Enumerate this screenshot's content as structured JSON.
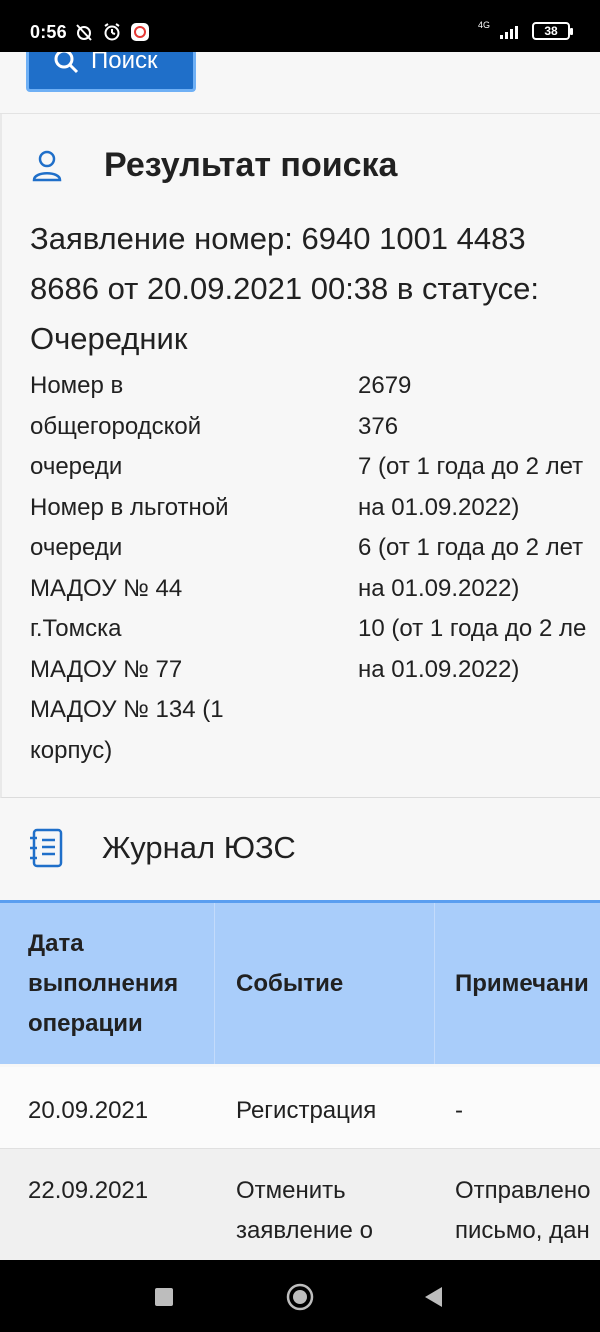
{
  "status_bar": {
    "time": "0:56",
    "network": "4G",
    "battery": "38"
  },
  "top_strip": {
    "search_button_label": "Поиск"
  },
  "result": {
    "title": "Результат поиска",
    "application_line_1": "Заявление номер: 6940 1001 4483",
    "application_line_2": "8686 от 20.09.2021 00:38 в статусе:",
    "application_line_3": "Очередник",
    "left_lines": [
      "Номер в",
      "общегородской",
      "очереди",
      "Номер в льготной",
      "очереди",
      "МАДОУ № 44",
      "г.Томска",
      "МАДОУ № 77",
      "МАДОУ № 134 (1",
      "корпус)"
    ],
    "right_lines": [
      "2679",
      "376",
      "7 (от 1 года до 2 лет",
      "на 01.09.2022)",
      "6 (от 1 года до 2 лет",
      "на 01.09.2022)",
      "10 (от 1 года до 2 ле",
      "на 01.09.2022)"
    ]
  },
  "journal": {
    "title": "Журнал ЮЗС",
    "columns": {
      "c1_line1": "Дата",
      "c1_line2": "выполнения",
      "c1_line3": "операции",
      "c2": "Событие",
      "c3": "Примечани"
    },
    "rows": [
      {
        "date": "20.09.2021",
        "event_line1": "Регистрация",
        "event_line2": "",
        "note_line1": "-",
        "note_line2": ""
      },
      {
        "date": "22.09.2021",
        "event_line1": "Отменить",
        "event_line2": "заявление о",
        "note_line1": "Отправлено",
        "note_line2": "письмо, дан"
      }
    ]
  },
  "colors": {
    "header_blue": "#a9cdfa",
    "button_blue": "#1f6fc9",
    "icon_blue": "#1f6fc9"
  }
}
